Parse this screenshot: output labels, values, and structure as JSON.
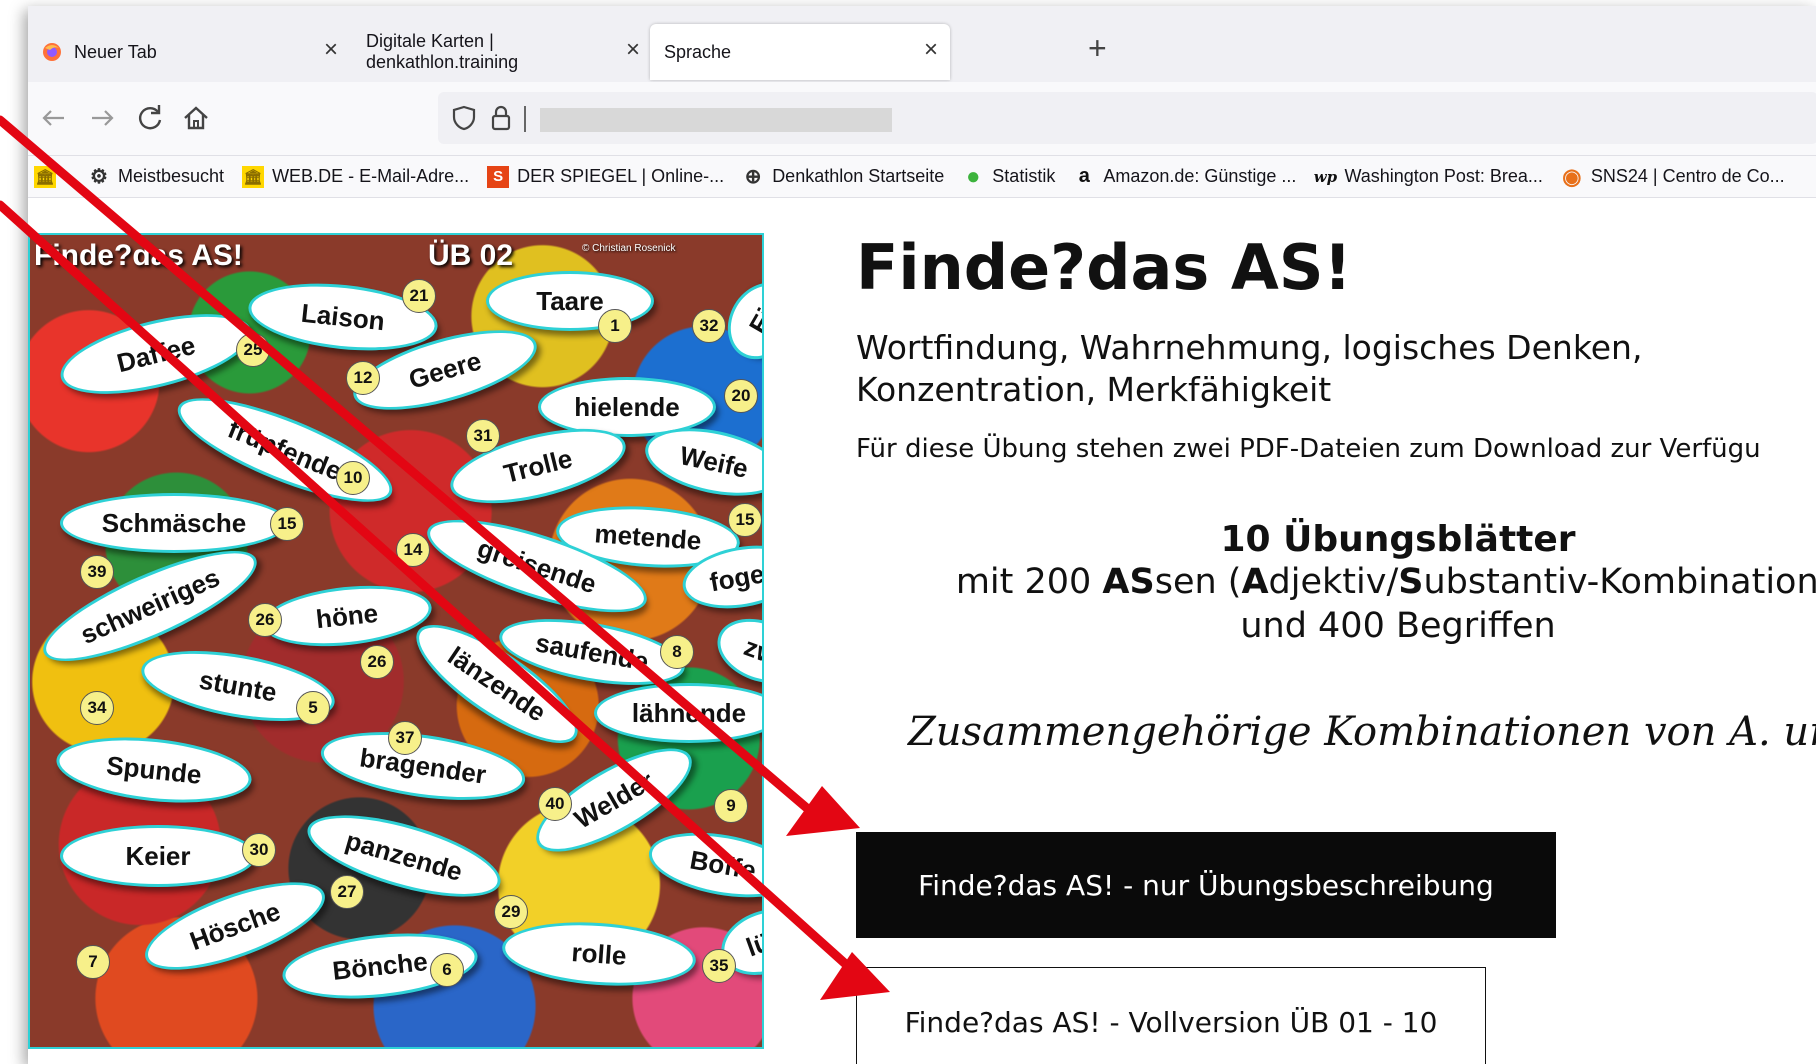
{
  "tabs": [
    {
      "title": "Neuer Tab",
      "icon": "firefox-icon",
      "close": "×"
    },
    {
      "title": "Digitale Karten | denkathlon.training",
      "icon": "",
      "close": "×"
    },
    {
      "title": "Sprache",
      "icon": "",
      "close": "×"
    }
  ],
  "new_tab": "+",
  "bookmarks": [
    {
      "label": "",
      "icon": "bank-icon",
      "glyph": "🏛"
    },
    {
      "label": "Meistbesucht",
      "icon": "gear-icon",
      "glyph": "⚙"
    },
    {
      "label": "WEB.DE - E-Mail-Adre...",
      "icon": "bank-icon",
      "glyph": "🏛"
    },
    {
      "label": "DER SPIEGEL | Online-...",
      "icon": "spiegel-icon",
      "glyph": "S"
    },
    {
      "label": "Denkathlon Startseite",
      "icon": "globe-icon",
      "glyph": "⊕"
    },
    {
      "label": "Statistik",
      "icon": "green-circle-icon",
      "glyph": "●"
    },
    {
      "label": "Amazon.de: Günstige ...",
      "icon": "amazon-icon",
      "glyph": "a"
    },
    {
      "label": "Washington Post: Brea...",
      "icon": "wp-icon",
      "glyph": "wp"
    },
    {
      "label": "SNS24 | Centro de Co...",
      "icon": "chrome-icon",
      "glyph": "◉"
    }
  ],
  "puzzle": {
    "title": "Finde?das AS!",
    "sheet": "ÜB 02",
    "copyright": "© Christian Rosenick",
    "words": [
      "Taare",
      "Laison",
      "Daffee",
      "Geere",
      "hielende",
      "Ei",
      "früpfende",
      "Trolle",
      "Weife",
      "Schmäsche",
      "metende",
      "greisende",
      "schweiriges",
      "foger",
      "höne",
      "saufende",
      "zw",
      "stunte",
      "länzende",
      "lähnende",
      "Spunde",
      "bragender",
      "Welder",
      "Keier",
      "panzende",
      "Boffe",
      "Hösche",
      "Bönche",
      "rolle",
      "lüs"
    ],
    "numbers": [
      "21",
      "1",
      "32",
      "25",
      "12",
      "20",
      "31",
      "10",
      "15",
      "15",
      "14",
      "39",
      "26",
      "8",
      "26",
      "5",
      "34",
      "37",
      "40",
      "9",
      "30",
      "27",
      "29",
      "7",
      "6",
      "35"
    ]
  },
  "article": {
    "heading": "Finde?das AS!",
    "subtitle": "Wortfindung, Wahrnehmung,  logisches Denken, Konzentration, Merkfähigkeit",
    "description": "Für diese Übung stehen zwei PDF-Dateien zum Download zur Verfügu",
    "sheets_title": "10 Übungsblätter",
    "sheets_line_a": "mit 200 ",
    "sheets_as": "AS",
    "sheets_line_b": "sen (",
    "sheets_A": "A",
    "sheets_adj": "djektiv/",
    "sheets_S": "S",
    "sheets_sub": "ubstantiv-Kombinatione",
    "sheets_line2": "und 400 Begriffen",
    "handwritten": "Zusammengehörige Kombinationen von A. und S.  finden",
    "button_description": "Finde?das AS! - nur Übungsbeschreibung",
    "button_full": "Finde?das AS! - Vollversion ÜB 01 - 10"
  },
  "colors": {
    "arrow": "#e30613",
    "oval_border": "#2ed1d6",
    "number_bg": "#f7f08a"
  }
}
